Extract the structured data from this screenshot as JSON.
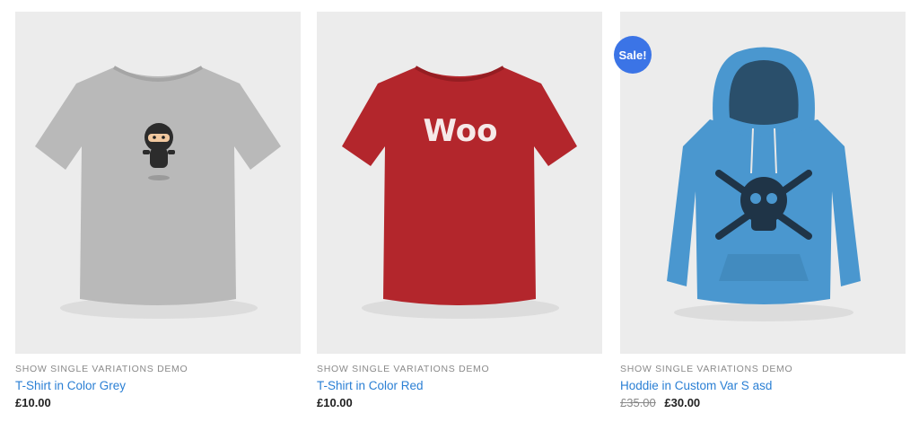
{
  "products": [
    {
      "category": "SHOW SINGLE VARIATIONS DEMO",
      "title": "T-Shirt in Color Grey",
      "price": "£10.00",
      "image_icon": "grey-tshirt-ninja-image",
      "color": "#b9b9b9"
    },
    {
      "category": "SHOW SINGLE VARIATIONS DEMO",
      "title": "T-Shirt in Color Red",
      "price": "£10.00",
      "image_icon": "red-tshirt-woo-image",
      "color": "#b3262c",
      "print_text": "Woo"
    },
    {
      "category": "SHOW SINGLE VARIATIONS DEMO",
      "title": "Hoddie in Custom Var S asd",
      "regular_price": "£35.00",
      "sale_price": "£30.00",
      "badge": "Sale!",
      "image_icon": "blue-hoodie-skull-image",
      "color": "#4a97cf"
    }
  ],
  "colors": {
    "link": "#2a7fd4",
    "badge": "#3b74e6",
    "tile_background": "#ececec"
  }
}
